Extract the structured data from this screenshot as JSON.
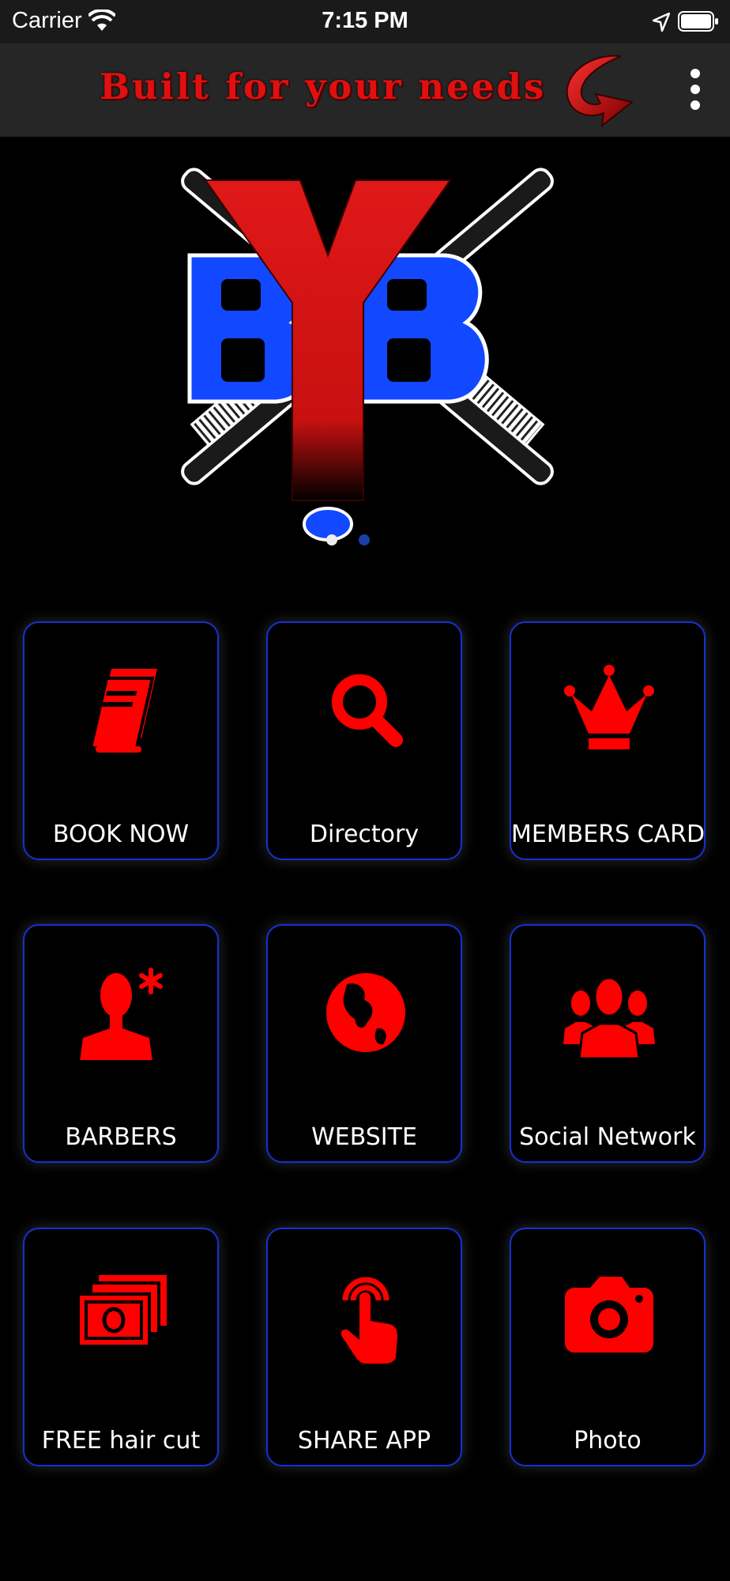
{
  "status_bar": {
    "carrier": "Carrier",
    "time": "7:15 PM"
  },
  "header": {
    "title": "Built for your needs",
    "accent_color": "#e01010"
  },
  "banner": {
    "logo_letters": "BYB",
    "page_count": 2,
    "active_page": 1
  },
  "grid": {
    "border_color": "#1530d8",
    "icon_color": "#ff0000",
    "items": [
      {
        "label": "BOOK NOW",
        "icon": "book-icon"
      },
      {
        "label": "Directory",
        "icon": "search-icon"
      },
      {
        "label": "MEMBERS CARD",
        "icon": "crown-icon"
      },
      {
        "label": "BARBERS",
        "icon": "person-icon"
      },
      {
        "label": "WEBSITE",
        "icon": "globe-icon"
      },
      {
        "label": "Social Network",
        "icon": "group-icon"
      },
      {
        "label": "FREE hair cut",
        "icon": "money-icon"
      },
      {
        "label": "SHARE APP",
        "icon": "tap-icon"
      },
      {
        "label": "Photo",
        "icon": "camera-icon"
      }
    ]
  }
}
